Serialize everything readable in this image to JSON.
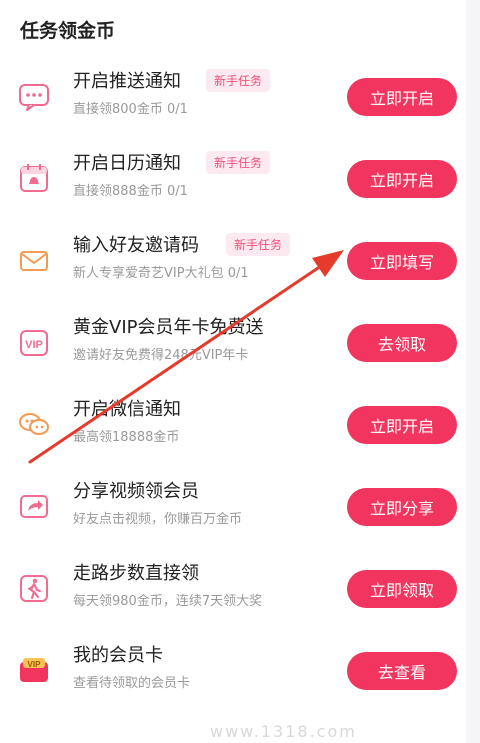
{
  "section": {
    "title": "任务领金币"
  },
  "tasks": [
    {
      "title": "开启推送通知",
      "badge": "新手任务",
      "desc": "直接领800金币 0/1",
      "button": "立即开启",
      "icon": "message-bell-icon"
    },
    {
      "title": "开启日历通知",
      "badge": "新手任务",
      "desc": "直接领888金币 0/1",
      "button": "立即开启",
      "icon": "calendar-icon"
    },
    {
      "title": "输入好友邀请码",
      "badge": "新手任务",
      "desc": "新人专享爱奇艺VIP大礼包 0/1",
      "button": "立即填写",
      "icon": "envelope-icon"
    },
    {
      "title": "黄金VIP会员年卡免费送",
      "badge": "",
      "desc": "邀请好友免费得248元VIP年卡",
      "button": "去领取",
      "icon": "vip-icon"
    },
    {
      "title": "开启微信通知",
      "badge": "",
      "desc": "最高领18888金币",
      "button": "立即开启",
      "icon": "wechat-icon"
    },
    {
      "title": "分享视频领会员",
      "badge": "",
      "desc": "好友点击视频，你赚百万金币",
      "button": "立即分享",
      "icon": "share-video-icon"
    },
    {
      "title": "走路步数直接领",
      "badge": "",
      "desc": "每天领980金币，连续7天领大奖",
      "button": "立即领取",
      "icon": "walking-icon"
    },
    {
      "title": "我的会员卡",
      "badge": "",
      "desc": "查看待领取的会员卡",
      "button": "去查看",
      "icon": "vip-card-icon"
    }
  ],
  "watermark": "www.1318.com",
  "colors": {
    "accent": "#f2355e",
    "badge_bg": "#fdeaf0",
    "badge_text": "#f0507a",
    "arrow": "#e53a2c"
  }
}
